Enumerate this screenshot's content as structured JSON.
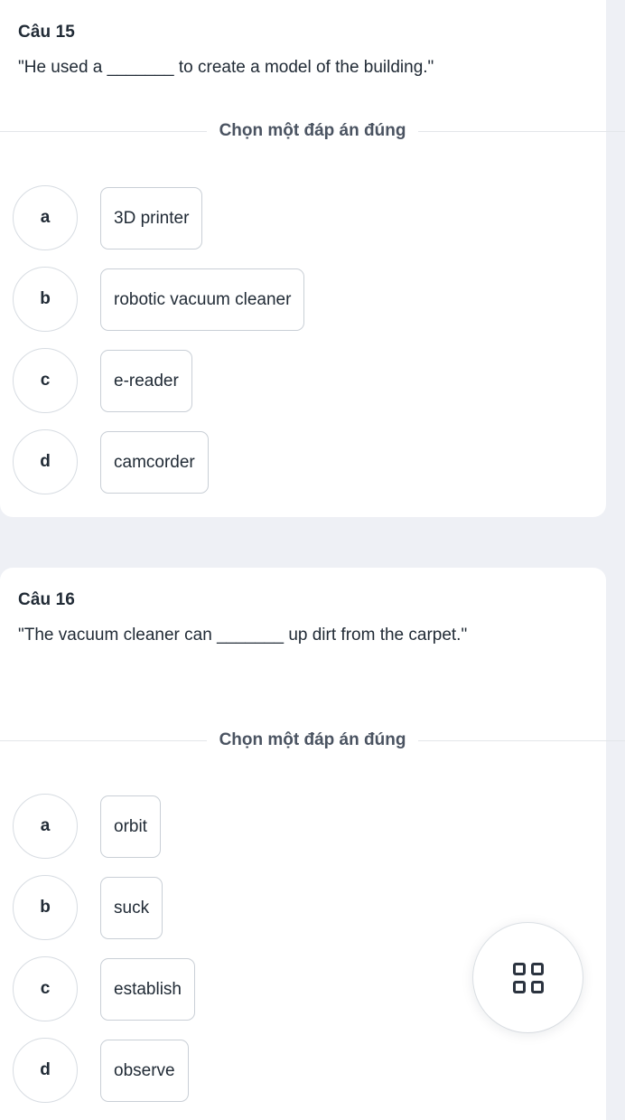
{
  "colors": {
    "page_background": "#eef0f5",
    "card_background": "#ffffff",
    "text_primary": "#212b36",
    "text_secondary": "#4a5361",
    "border": "#c9cfd6",
    "divider": "#e3e6ea"
  },
  "questions": [
    {
      "number_label": "Câu 15",
      "prompt": "\"He used a _______ to create a model of the building.\"",
      "instruction": "Chọn một đáp án đúng",
      "options": [
        {
          "letter": "a",
          "text": "3D printer"
        },
        {
          "letter": "b",
          "text": "robotic vacuum cleaner"
        },
        {
          "letter": "c",
          "text": "e-reader"
        },
        {
          "letter": "d",
          "text": "camcorder"
        }
      ]
    },
    {
      "number_label": "Câu 16",
      "prompt": "\"The vacuum cleaner can _______ up dirt from the carpet.\"",
      "instruction": "Chọn một đáp án đúng",
      "options": [
        {
          "letter": "a",
          "text": "orbit"
        },
        {
          "letter": "b",
          "text": "suck"
        },
        {
          "letter": "c",
          "text": "establish"
        },
        {
          "letter": "d",
          "text": "observe"
        }
      ]
    }
  ],
  "floating_button": {
    "icon": "grid-icon"
  }
}
